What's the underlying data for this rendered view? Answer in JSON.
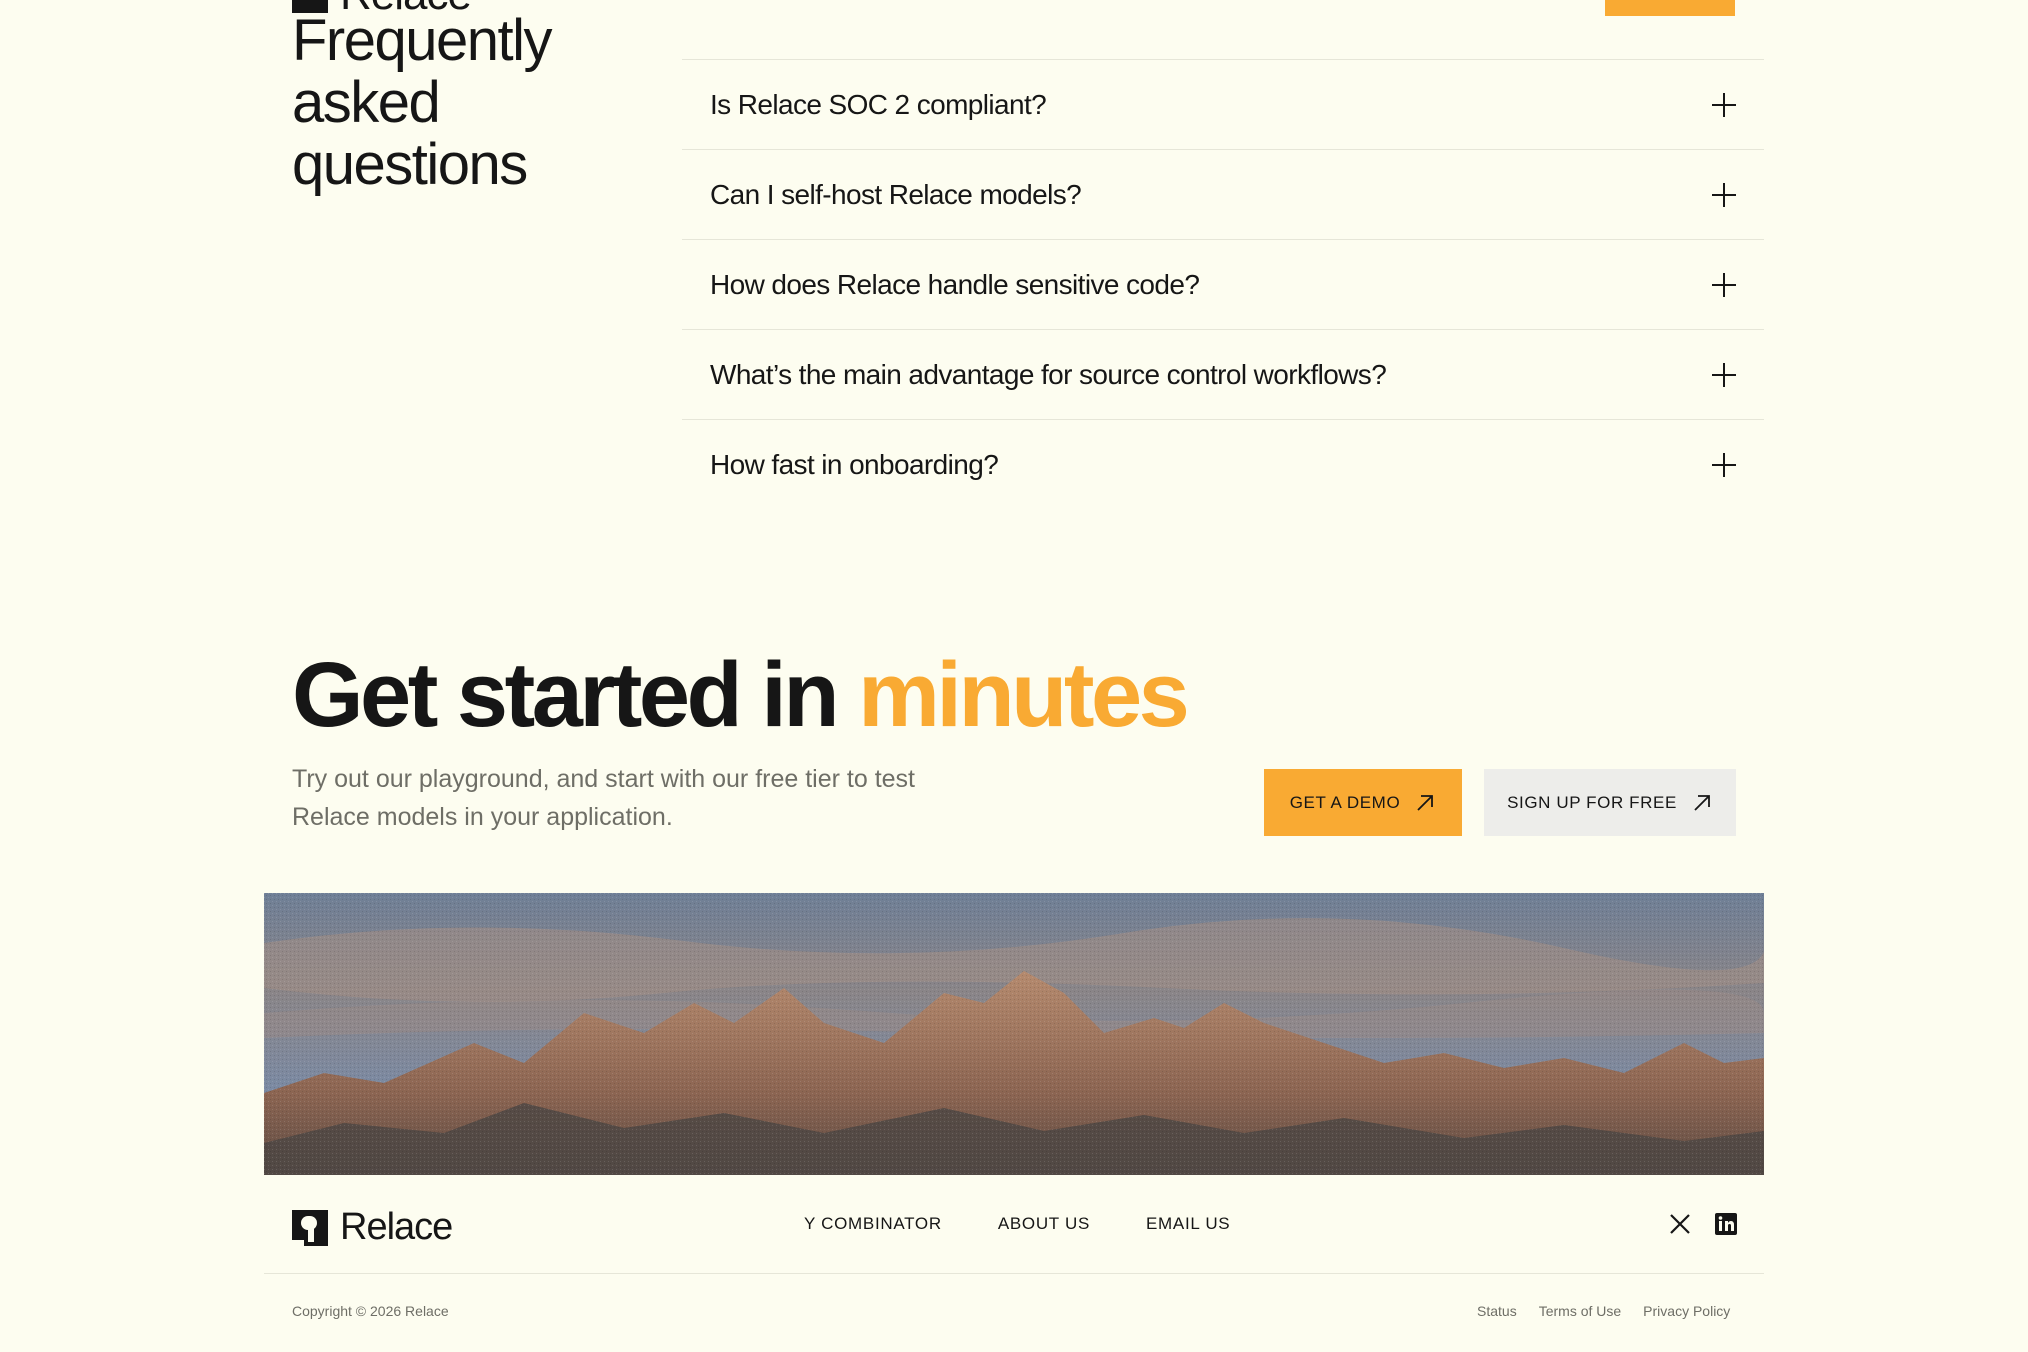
{
  "header": {
    "brand": "Relace"
  },
  "faq": {
    "title": "Frequently asked questions",
    "items": [
      {
        "question": "Is Relace SOC 2 compliant?"
      },
      {
        "question": "Can I self-host Relace models?"
      },
      {
        "question": "How does Relace handle sensitive code?"
      },
      {
        "question": "What’s the main advantage for source control workflows?"
      },
      {
        "question": "How fast in onboarding?"
      }
    ]
  },
  "cta": {
    "heading_main": "Get started in ",
    "heading_accent": "minutes",
    "subtitle": "Try out our playground, and start with our free tier to test Relace models in your application.",
    "demo_button": "GET A DEMO",
    "signup_button": "SIGN UP FOR FREE"
  },
  "footer": {
    "brand": "Relace",
    "nav": [
      "Y COMBINATOR",
      "ABOUT US",
      "EMAIL US"
    ],
    "social_icons": [
      "x-icon",
      "linkedin-icon"
    ],
    "copyright": "Copyright © 2026 Relace",
    "legal": [
      "Status",
      "Terms of Use",
      "Privacy Policy"
    ]
  },
  "colors": {
    "background": "#fdfdf0",
    "accent": "#f9aa33",
    "text": "#161616",
    "muted": "#6e6e66"
  }
}
